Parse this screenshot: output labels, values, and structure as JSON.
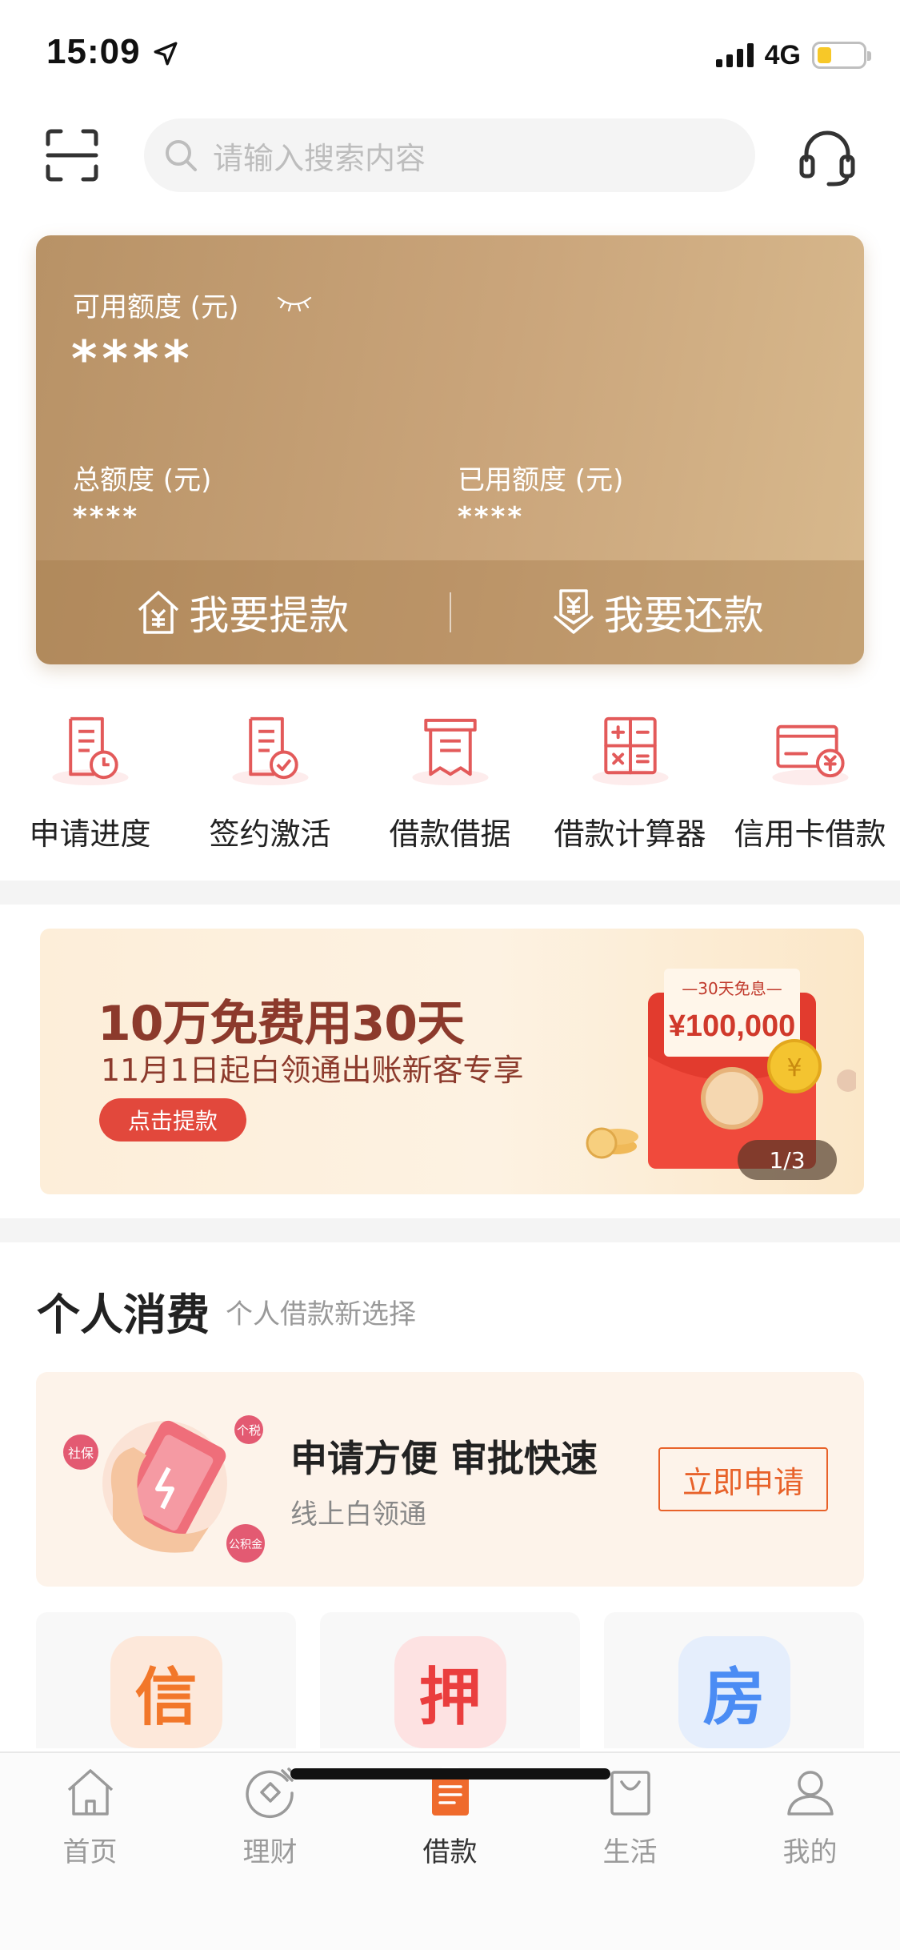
{
  "status_bar": {
    "time": "15:09",
    "network": "4G",
    "battery_color": "#f7c828"
  },
  "header": {
    "search_placeholder": "请输入搜索内容",
    "scan_icon": "scan-icon",
    "service_icon": "headset-icon"
  },
  "credit_card": {
    "available_label": "可用额度 (元)",
    "available_value": "****",
    "total_label": "总额度 (元)",
    "total_value": "****",
    "used_label": "已用额度 (元)",
    "used_value": "****",
    "withdraw_label": "我要提款",
    "repay_label": "我要还款"
  },
  "quick_menu": [
    {
      "label": "申请进度",
      "icon": "application-progress-icon"
    },
    {
      "label": "签约激活",
      "icon": "sign-activate-icon"
    },
    {
      "label": "借款借据",
      "icon": "loan-receipt-icon"
    },
    {
      "label": "借款计算器",
      "icon": "calculator-icon"
    },
    {
      "label": "信用卡借款",
      "icon": "credit-card-loan-icon"
    }
  ],
  "banner": {
    "title": "10万免费用30天",
    "subtitle": "11月1日起白领通出账新客专享",
    "button": "点击提款",
    "envelope_tag": "—30天免息—",
    "envelope_amount": "¥100,000",
    "pager": "1/3"
  },
  "section": {
    "title": "个人消费",
    "subtitle": "个人借款新选择",
    "promo": {
      "title": "申请方便 审批快速",
      "subtitle": "线上白领通",
      "button": "立即申请",
      "tags": [
        "社保",
        "个税",
        "公积金"
      ]
    },
    "loan_types": [
      {
        "char": "信"
      },
      {
        "char": "押"
      },
      {
        "char": "房"
      }
    ]
  },
  "tabbar": {
    "tabs": [
      {
        "label": "首页",
        "icon": "home-icon"
      },
      {
        "label": "理财",
        "icon": "wealth-icon"
      },
      {
        "label": "借款",
        "icon": "loan-icon",
        "active": true
      },
      {
        "label": "生活",
        "icon": "shopping-bag-icon"
      },
      {
        "label": "我的",
        "icon": "profile-icon"
      }
    ]
  },
  "colors": {
    "accent": "#e8622a",
    "card_gold": "#c9a277",
    "icon_red": "#e35a5a"
  }
}
